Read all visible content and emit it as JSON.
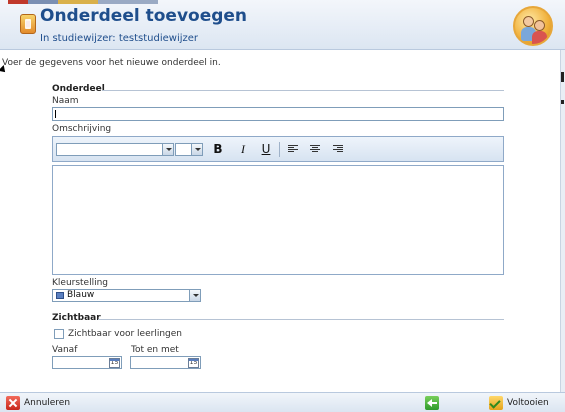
{
  "header": {
    "title": "Onderdeel toevoegen",
    "subtitle": "In studiewijzer: teststudiewijzer"
  },
  "intro_text": "Voer de gegevens voor het nieuwe onderdeel in.",
  "onderdeel": {
    "section_title": "Onderdeel",
    "name_label": "Naam",
    "name_value": "",
    "description_label": "Omschrijving",
    "toolbar": {
      "bold": "B",
      "italic": "I",
      "underline": "U"
    }
  },
  "color_scheme": {
    "label": "Kleurstelling",
    "selected": "Blauw",
    "swatch_color": "#5a7fc0"
  },
  "visibility": {
    "section_title": "Zichtbaar",
    "checkbox_label": "Zichtbaar voor leerlingen",
    "checked": false,
    "from_label": "Vanaf",
    "to_label": "Tot en met",
    "calendar_icon_text": "15"
  },
  "footer": {
    "cancel_label": "Annuleren",
    "finish_label": "Voltooien"
  }
}
